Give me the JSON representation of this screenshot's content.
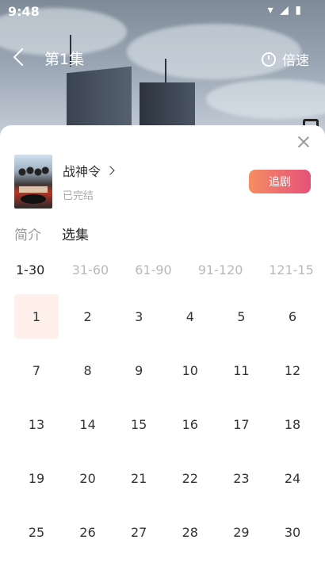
{
  "status_bar": {
    "time": "9:48",
    "icons": "▾ ◢ ▮"
  },
  "player": {
    "episode_title": "第1集",
    "speed_label": "倍速"
  },
  "drama": {
    "title": "战神令",
    "status": "已完结",
    "follow_label": "追剧"
  },
  "tabs": [
    {
      "label": "简介",
      "active": false
    },
    {
      "label": "选集",
      "active": true
    }
  ],
  "ranges": [
    {
      "label": "1-30",
      "active": true
    },
    {
      "label": "31-60",
      "active": false
    },
    {
      "label": "61-90",
      "active": false
    },
    {
      "label": "91-120",
      "active": false
    },
    {
      "label": "121-15",
      "active": false
    }
  ],
  "episodes": [
    "1",
    "2",
    "3",
    "4",
    "5",
    "6",
    "7",
    "8",
    "9",
    "10",
    "11",
    "12",
    "13",
    "14",
    "15",
    "16",
    "17",
    "18",
    "19",
    "20",
    "21",
    "22",
    "23",
    "24",
    "25",
    "26",
    "27",
    "28",
    "29",
    "30"
  ],
  "selected_episode": "1",
  "colors": {
    "accent_start": "#f68d62",
    "accent_end": "#e5517a",
    "selected_bg": "#fff0ec"
  }
}
